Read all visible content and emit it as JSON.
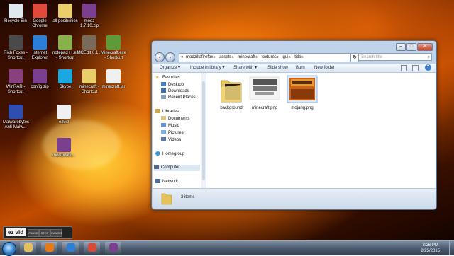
{
  "desktop": {
    "icons": [
      {
        "label": "Recycle Bin",
        "color": "#dfe7ef"
      },
      {
        "label": "Google Chrome",
        "color": "#e04a3a"
      },
      {
        "label": "all posibilities",
        "color": "#e9cf6b"
      },
      {
        "label": "modz 1.7.10.zip",
        "color": "#7a3f8f"
      },
      {
        "label": "Rich Foxes - Shortcut",
        "color": "#4a4a4a"
      },
      {
        "label": "Internet Explorer",
        "color": "#2c7fd4"
      },
      {
        "label": "notepad++.exe - Shortcut",
        "color": "#88b04b"
      },
      {
        "label": "MCEdit 0.1...",
        "color": "#7a6a5a"
      },
      {
        "label": "Minecraft.exe - Shortcut",
        "color": "#5e9a3a"
      },
      {
        "label": "WinRAR - Shortcut",
        "color": "#8a3f7f"
      },
      {
        "label": "config.zip",
        "color": "#7a3f8f"
      },
      {
        "label": "Skype",
        "color": "#1ba7e0"
      },
      {
        "label": "minecraft - Shortcut",
        "color": "#e9cf6b"
      },
      {
        "label": "minecraft.jar",
        "color": "#f0f0f0"
      },
      {
        "label": "Malwarebytes Anti-Malw...",
        "color": "#2f4fb0"
      },
      {
        "label": "ezvid",
        "color": "#f0f0f0"
      },
      {
        "label": "modzillafir...",
        "color": "#7a3f8f"
      }
    ]
  },
  "explorer": {
    "address": {
      "chevron": "«",
      "segments": [
        "modzillafirefox",
        "assets",
        "minecraft",
        "textures",
        "gui",
        "title"
      ]
    },
    "search_placeholder": "Search title",
    "window_controls": {
      "minimize": "–",
      "maximize": "□",
      "close": "X"
    },
    "toolbar": [
      "Organize ▾",
      "Include in library ▾",
      "Share with ▾",
      "Slide show",
      "Burn",
      "New folder"
    ],
    "nav": {
      "favorites": {
        "label": "Favorites",
        "items": [
          "Desktop",
          "Downloads",
          "Recent Places"
        ]
      },
      "libraries": {
        "label": "Libraries",
        "items": [
          "Documents",
          "Music",
          "Pictures",
          "Videos"
        ]
      },
      "homegroup": "Homegroup",
      "computer": "Computer",
      "network": "Network"
    },
    "files": [
      {
        "name": "background",
        "kind": "folder"
      },
      {
        "name": "minecraft.png",
        "kind": "image"
      },
      {
        "name": "mojang.png",
        "kind": "image"
      }
    ],
    "status": "3 items"
  },
  "ezvid": {
    "logo": "ez vid",
    "buttons": [
      "PAUSE",
      "STOP",
      "CANCEL"
    ]
  },
  "taskbar": {
    "apps": [
      "windows-explorer",
      "windows-media-player",
      "internet-explorer",
      "google-chrome",
      "winrar"
    ],
    "time": "8:26 PM",
    "date": "2/25/2015"
  }
}
